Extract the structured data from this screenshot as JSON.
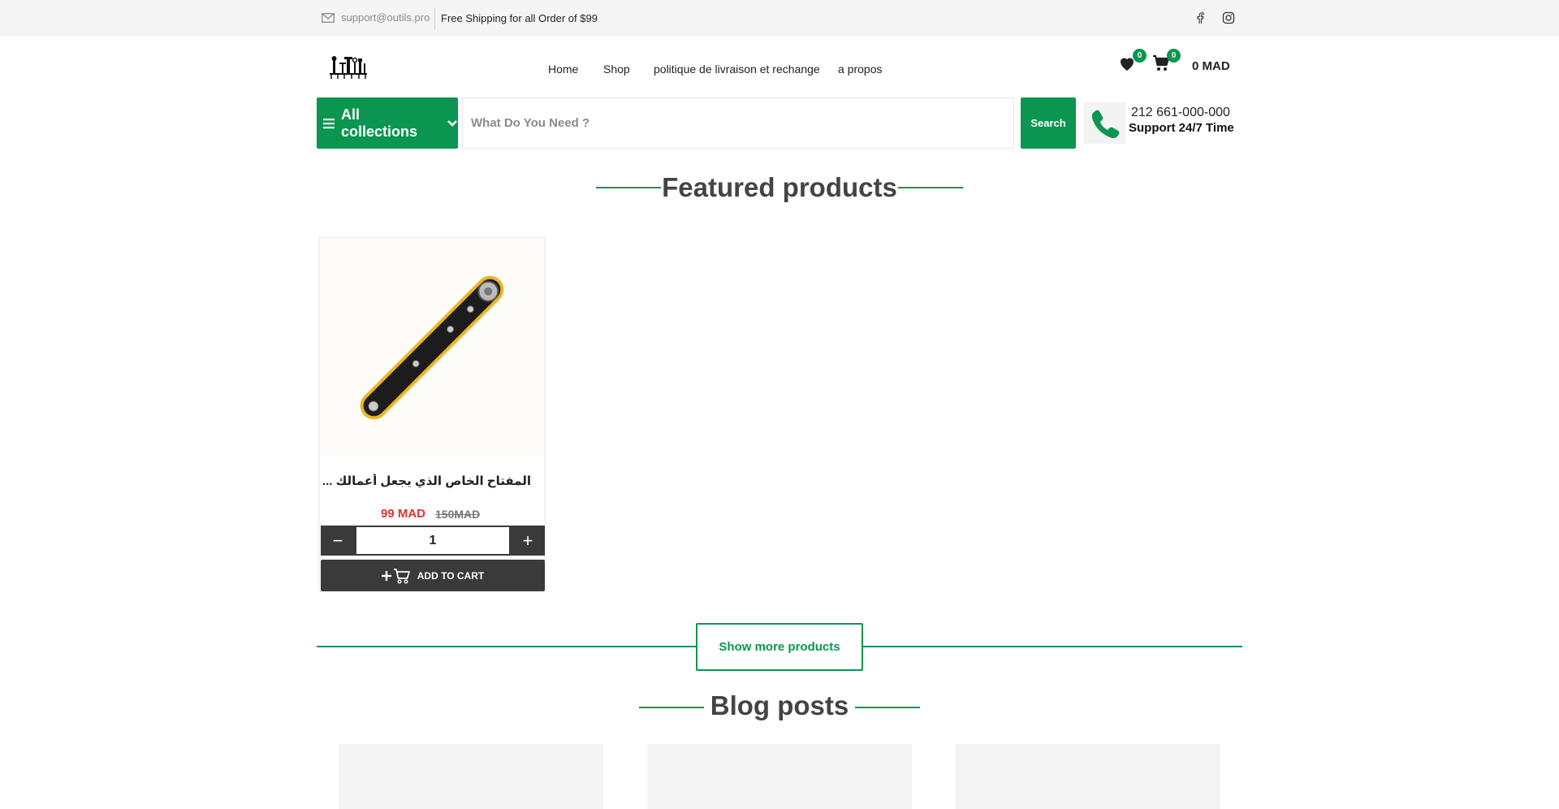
{
  "topbar": {
    "email": "support@outils.pro",
    "shipping": "Free Shipping for all Order of $99",
    "icons": [
      "mail-icon",
      "facebook-icon",
      "instagram-icon"
    ]
  },
  "header": {
    "logo_alt": "outils logo",
    "nav": [
      "Home",
      "Shop",
      "politique de livraison et rechange",
      "a propos"
    ],
    "wishlist_count": "0",
    "cart_count": "0",
    "cart_total": "0 MAD"
  },
  "search": {
    "collections_label": "All collections",
    "placeholder": "What Do You Need ?",
    "button": "Search"
  },
  "support": {
    "phone": "212 661-000-000",
    "label": "Support 24/7 Time"
  },
  "featured": {
    "title": "Featured products",
    "products": [
      {
        "name": "المفتاح الخاص الذي يجعل أعمالك ...",
        "price": "99 MAD",
        "old_price": "150MAD",
        "quantity": "1",
        "add_to_cart": "ADD TO CART"
      }
    ],
    "show_more": "Show more products"
  },
  "blog": {
    "title": "Blog posts"
  },
  "colors": {
    "brand": "#0a9650",
    "sale": "#d9342b",
    "dark": "#3a3a3a"
  }
}
